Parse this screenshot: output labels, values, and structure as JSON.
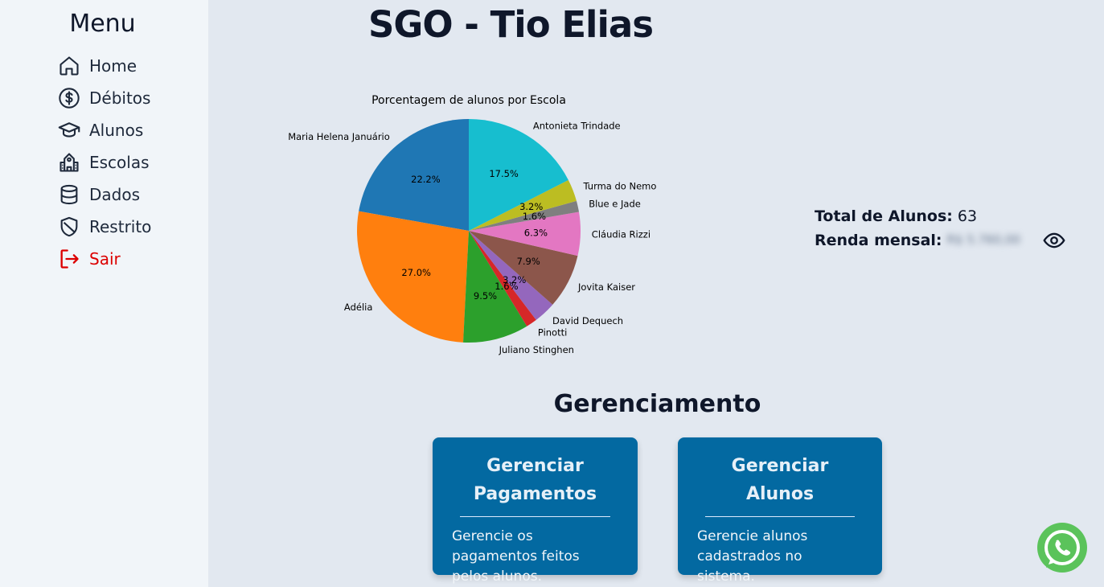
{
  "sidebar": {
    "title": "Menu",
    "items": [
      {
        "label": "Home",
        "icon": "home-icon"
      },
      {
        "label": "Débitos",
        "icon": "dollar-circle-icon"
      },
      {
        "label": "Alunos",
        "icon": "graduation-cap-icon"
      },
      {
        "label": "Escolas",
        "icon": "school-icon"
      },
      {
        "label": "Dados",
        "icon": "database-icon"
      },
      {
        "label": "Restrito",
        "icon": "shield-icon"
      },
      {
        "label": "Sair",
        "icon": "logout-icon"
      }
    ],
    "logout_color": "#dc0000"
  },
  "header": {
    "title": "SGO - Tio Elias"
  },
  "stats": {
    "total_label": "Total de Alunos:",
    "total_value": "63",
    "income_label": "Renda mensal:",
    "income_value": "R$ 5.760,00"
  },
  "chart_data": {
    "type": "pie",
    "title": "Porcentagem de alunos por Escola",
    "categories": [
      "Maria Helena Januário",
      "Adélia",
      "Juliano Stinghen",
      "Pinotti",
      "David Dequech",
      "Jovita Kaiser",
      "Cláudia Rizzi",
      "Blue e Jade",
      "Turma do Nemo",
      "Antonieta Trindade"
    ],
    "values": [
      22.2,
      27.0,
      9.5,
      1.6,
      3.2,
      7.9,
      6.3,
      1.6,
      3.2,
      17.5
    ],
    "value_labels": [
      "22.2%",
      "27.0%",
      "9.5%",
      "1.6%",
      "3.2%",
      "7.9%",
      "6.3%",
      "1.6%",
      "3.2%",
      "17.5%"
    ],
    "colors": [
      "#1f77b4",
      "#ff7f0e",
      "#2ca02c",
      "#d62728",
      "#9467bd",
      "#8c564b",
      "#e377c2",
      "#7f7f7f",
      "#bcbd22",
      "#17becf"
    ],
    "start_angle": 90,
    "direction": "counterclockwise"
  },
  "management": {
    "title": "Gerenciamento",
    "cards": [
      {
        "title": "Gerenciar Pagamentos",
        "description": "Gerencie os pagamentos feitos pelos alunos."
      },
      {
        "title": "Gerenciar Alunos",
        "description": "Gerencie alunos cadastrados no sistema."
      }
    ],
    "card_color": "#0369a1"
  },
  "whatsapp": {
    "icon": "whatsapp-icon",
    "color": "#5bc35b"
  }
}
